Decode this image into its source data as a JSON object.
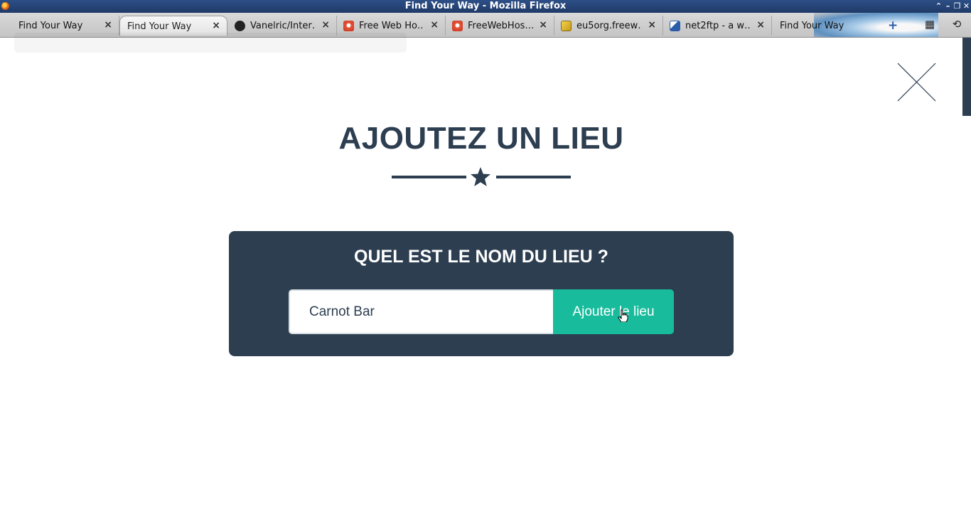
{
  "window": {
    "title": "Find Your Way - Mozilla Firefox",
    "controls": [
      "⌃",
      "–",
      "❐",
      "✕"
    ]
  },
  "tabs": [
    {
      "label": "Find Your Way",
      "active": false,
      "icon": null
    },
    {
      "label": "Find Your Way",
      "active": true,
      "icon": null
    },
    {
      "label": "Vanelric/Inter…",
      "active": false,
      "icon": "github-icon"
    },
    {
      "label": "Free Web Ho…",
      "active": false,
      "icon": "freewebhosting-icon"
    },
    {
      "label": "FreeWebHos…",
      "active": false,
      "icon": "freewebhosting-icon"
    },
    {
      "label": "eu5org.freew…",
      "active": false,
      "icon": "eu5-icon"
    },
    {
      "label": "net2ftp - a w…",
      "active": false,
      "icon": "net2ftp-icon"
    },
    {
      "label": "Find Your Way",
      "active": false,
      "icon": null
    }
  ],
  "tabbar": {
    "close_glyph": "×",
    "new_tab_glyph": "+",
    "group_glyph": "▦",
    "history_glyph": "⟲"
  },
  "page": {
    "title": "AJOUTEZ UN LIEU",
    "form": {
      "question": "QUEL EST LE NOM DU LIEU ?",
      "input_value": "Carnot Bar",
      "submit_label": "Ajouter le lieu"
    }
  },
  "colors": {
    "primary": "#2c3e50",
    "accent": "#18bc9c",
    "titlebar": "#1f3a68"
  }
}
